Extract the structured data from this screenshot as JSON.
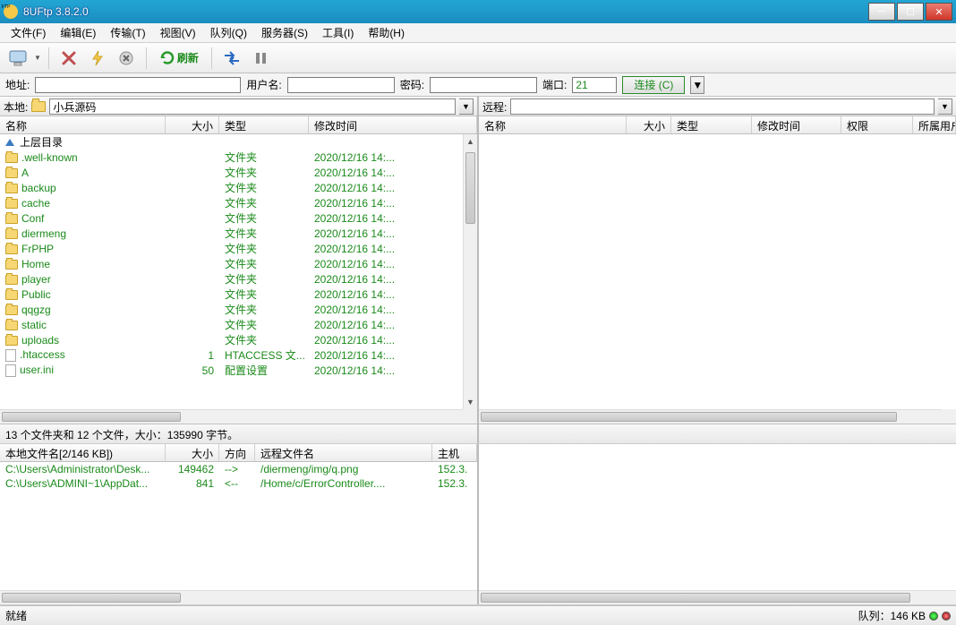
{
  "window": {
    "title": "8UFtp 3.8.2.0"
  },
  "menu": {
    "file": "文件(F)",
    "edit": "编辑(E)",
    "transfer": "传输(T)",
    "view": "视图(V)",
    "queue": "队列(Q)",
    "server": "服务器(S)",
    "tools": "工具(I)",
    "help": "帮助(H)"
  },
  "toolbar": {
    "refresh": "刷新"
  },
  "conn": {
    "addr_label": "地址:",
    "addr": "",
    "user_label": "用户名:",
    "user": "",
    "pass_label": "密码:",
    "pass": "",
    "port_label": "端口:",
    "port": "21",
    "connect": "连接 (C)"
  },
  "local": {
    "label": "本地:",
    "path": "小兵源码",
    "cols": {
      "name": "名称",
      "size": "大小",
      "type": "类型",
      "mtime": "修改时间"
    },
    "parent": "上层目录",
    "rows": [
      {
        "name": ".well-known",
        "size": "",
        "type": "文件夹",
        "mtime": "2020/12/16 14:...",
        "kind": "folder"
      },
      {
        "name": "A",
        "size": "",
        "type": "文件夹",
        "mtime": "2020/12/16 14:...",
        "kind": "folder"
      },
      {
        "name": "backup",
        "size": "",
        "type": "文件夹",
        "mtime": "2020/12/16 14:...",
        "kind": "folder"
      },
      {
        "name": "cache",
        "size": "",
        "type": "文件夹",
        "mtime": "2020/12/16 14:...",
        "kind": "folder"
      },
      {
        "name": "Conf",
        "size": "",
        "type": "文件夹",
        "mtime": "2020/12/16 14:...",
        "kind": "folder"
      },
      {
        "name": "diermeng",
        "size": "",
        "type": "文件夹",
        "mtime": "2020/12/16 14:...",
        "kind": "folder"
      },
      {
        "name": "FrPHP",
        "size": "",
        "type": "文件夹",
        "mtime": "2020/12/16 14:...",
        "kind": "folder"
      },
      {
        "name": "Home",
        "size": "",
        "type": "文件夹",
        "mtime": "2020/12/16 14:...",
        "kind": "folder"
      },
      {
        "name": "player",
        "size": "",
        "type": "文件夹",
        "mtime": "2020/12/16 14:...",
        "kind": "folder"
      },
      {
        "name": "Public",
        "size": "",
        "type": "文件夹",
        "mtime": "2020/12/16 14:...",
        "kind": "folder"
      },
      {
        "name": "qqgzg",
        "size": "",
        "type": "文件夹",
        "mtime": "2020/12/16 14:...",
        "kind": "folder"
      },
      {
        "name": "static",
        "size": "",
        "type": "文件夹",
        "mtime": "2020/12/16 14:...",
        "kind": "folder"
      },
      {
        "name": "uploads",
        "size": "",
        "type": "文件夹",
        "mtime": "2020/12/16 14:...",
        "kind": "folder"
      },
      {
        "name": ".htaccess",
        "size": "1",
        "type": "HTACCESS 文...",
        "mtime": "2020/12/16 14:...",
        "kind": "file"
      },
      {
        "name": "user.ini",
        "size": "50",
        "type": "配置设置",
        "mtime": "2020/12/16 14:...",
        "kind": "file"
      }
    ],
    "status": "13 个文件夹和 12 个文件，大小：135990 字节。"
  },
  "remote": {
    "label": "远程:",
    "path": "",
    "cols": {
      "name": "名称",
      "size": "大小",
      "type": "类型",
      "mtime": "修改时间",
      "perm": "权限",
      "owner": "所属用户"
    }
  },
  "queue": {
    "cols": {
      "localname": "本地文件名[2/146 KB])",
      "size": "大小",
      "dir": "方向",
      "remotename": "远程文件名",
      "host": "主机"
    },
    "rows": [
      {
        "local": "C:\\Users\\Administrator\\Desk...",
        "size": "149462",
        "dir": "-->",
        "remote": "/diermeng/img/q.png",
        "host": "152.3."
      },
      {
        "local": "C:\\Users\\ADMINI~1\\AppDat...",
        "size": "841",
        "dir": "<--",
        "remote": "/Home/c/ErrorController....",
        "host": "152.3."
      }
    ]
  },
  "status": {
    "ready": "就绪",
    "queue": "队列：146 KB"
  }
}
